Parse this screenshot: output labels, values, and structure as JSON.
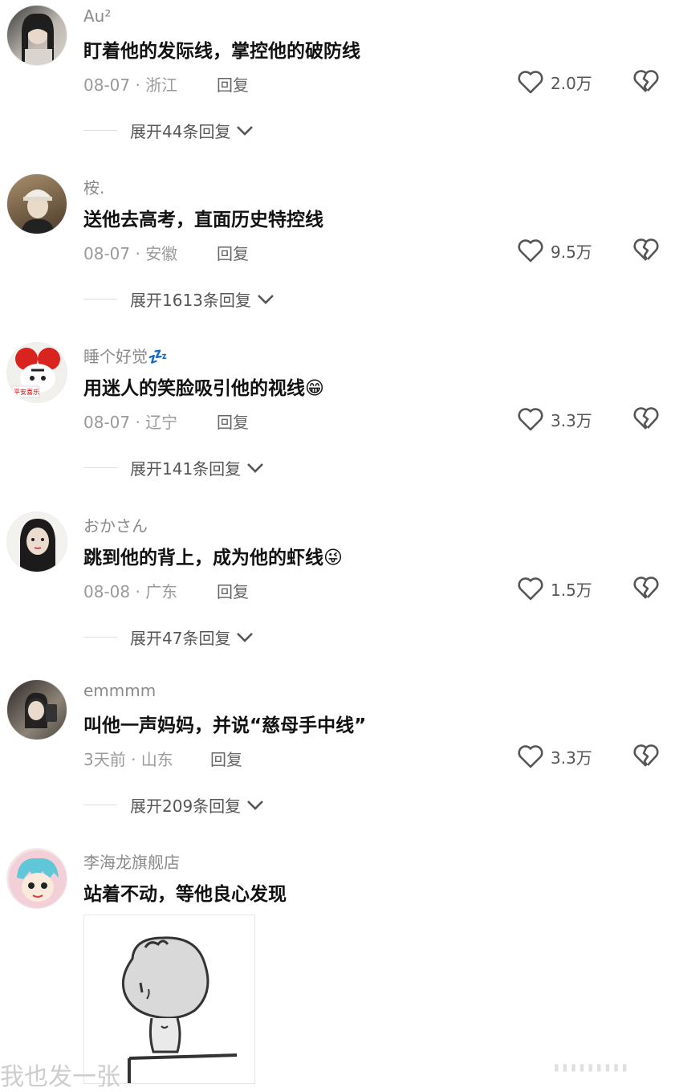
{
  "comments": [
    {
      "username": "Au²",
      "content": "盯着他的发际线，掌控他的破防线",
      "date": "08-07",
      "location": "浙江",
      "meta": "08-07 · 浙江",
      "reply": "回复",
      "likes": "2.0万",
      "expand": "展开44条回复",
      "avatar": "girl-dark-hair"
    },
    {
      "username": "桉.",
      "content": "送他去高考，直面历史特控线",
      "date": "08-07",
      "location": "安徽",
      "meta": "08-07 · 安徽",
      "reply": "回复",
      "likes": "9.5万",
      "expand": "展开1613条回复",
      "avatar": "girl-with-cap"
    },
    {
      "username": "睡个好觉💤",
      "content": "用迷人的笑脸吸引他的视线😁",
      "date": "08-07",
      "location": "辽宁",
      "meta": "08-07 · 辽宁",
      "reply": "回复",
      "likes": "3.3万",
      "expand": "展开141条回复",
      "avatar": "cartoon-red-hat",
      "avatar_text": "平安喜乐"
    },
    {
      "username": "おかさん",
      "content": "跳到他的背上，成为他的虾线😜",
      "date": "08-08",
      "location": "广东",
      "meta": "08-08 · 广东",
      "reply": "回复",
      "likes": "1.5万",
      "expand": "展开47条回复",
      "avatar": "girl-portrait"
    },
    {
      "username": "emmmm",
      "content": "叫他一声妈妈，并说“慈母手中线”",
      "date": "3天前",
      "location": "山东",
      "meta": "3天前 · 山东",
      "reply": "回复",
      "likes": "3.3万",
      "expand": "展开209条回复",
      "avatar": "selfie-dark"
    },
    {
      "username": "李海龙旗舰店",
      "content": "站着不动，等他良心发现",
      "avatar": "cartoon-blue-hair"
    }
  ],
  "watermark": "我也发一张",
  "colors": {
    "text": "#111111",
    "meta": "#9a9a9a",
    "icon": "#555555"
  },
  "icons": [
    "heart-outline-icon",
    "broken-heart-icon",
    "chevron-down-icon"
  ]
}
